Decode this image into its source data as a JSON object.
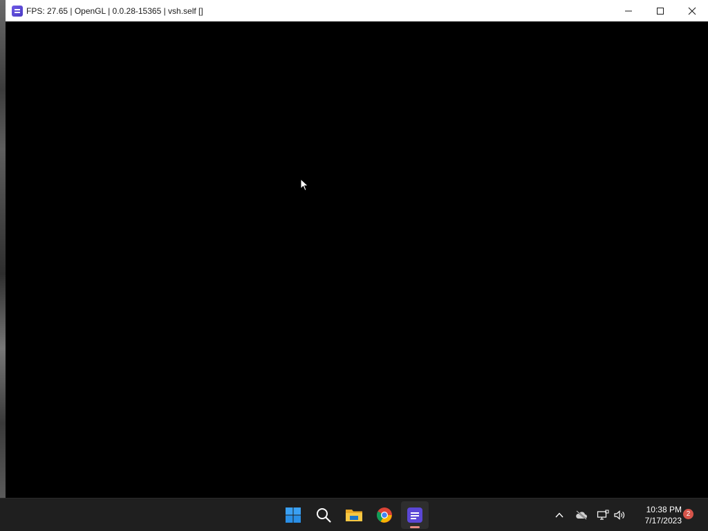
{
  "window": {
    "title": "FPS: 27.65 | OpenGL | 0.0.28-15365 | vsh.self []",
    "app_icon": "rpcs3-icon",
    "controls": [
      "minimize-icon",
      "maximize-icon",
      "close-icon"
    ]
  },
  "taskbar": {
    "apps": [
      {
        "name": "start",
        "icon": "windows-start-icon"
      },
      {
        "name": "search",
        "icon": "search-icon"
      },
      {
        "name": "file-explorer",
        "icon": "folder-icon"
      },
      {
        "name": "chrome",
        "icon": "chrome-icon"
      },
      {
        "name": "rpcs3",
        "icon": "rpcs3-icon",
        "active": true
      }
    ],
    "tray": {
      "icons": [
        "chevron-up-icon",
        "cloud-offline-icon",
        "network-icon",
        "volume-icon"
      ],
      "time": "10:38 PM",
      "date": "7/17/2023",
      "notification_count": "2"
    }
  },
  "colors": {
    "accent": "#5b47d6",
    "taskbar_bg": "#1f1f1f",
    "badge": "#d6544a"
  }
}
